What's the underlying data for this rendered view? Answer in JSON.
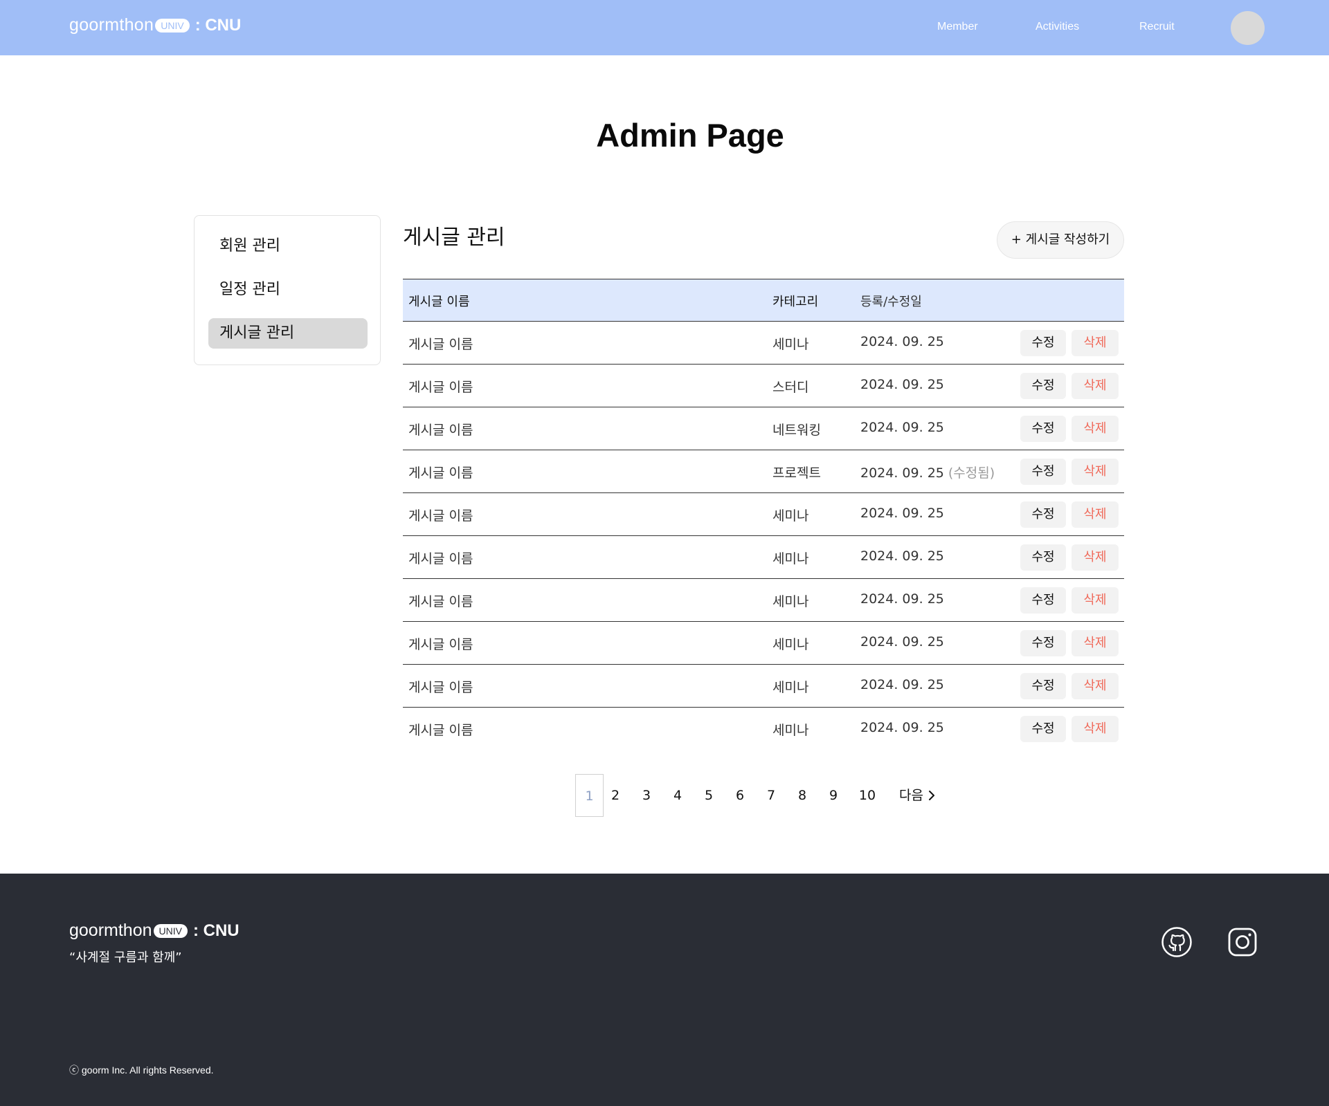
{
  "header": {
    "logo": {
      "wordmark": "goormthon",
      "badge": "UNIV",
      "suffix": ": CNU"
    },
    "nav": [
      "Member",
      "Activities",
      "Recruit"
    ]
  },
  "page_title": "Admin Page",
  "sidebar": {
    "items": [
      "회원 관리",
      "일정 관리",
      "게시글 관리"
    ],
    "active_index": 2
  },
  "section": {
    "title": "게시글 관리",
    "write_button": "+ 게시글 작성하기"
  },
  "table": {
    "headers": [
      "게시글 이름",
      "카테고리",
      "등록/수정일"
    ],
    "edit_label": "수정",
    "delete_label": "삭제",
    "rows": [
      {
        "name": "게시글 이름",
        "category": "세미나",
        "date": "2024. 09. 25",
        "note": ""
      },
      {
        "name": "게시글 이름",
        "category": "스터디",
        "date": "2024. 09. 25",
        "note": ""
      },
      {
        "name": "게시글 이름",
        "category": "네트워킹",
        "date": "2024. 09. 25",
        "note": ""
      },
      {
        "name": "게시글 이름",
        "category": "프로젝트",
        "date": "2024. 09. 25",
        "note": "(수정됨)"
      },
      {
        "name": "게시글 이름",
        "category": "세미나",
        "date": "2024. 09. 25",
        "note": ""
      },
      {
        "name": "게시글 이름",
        "category": "세미나",
        "date": "2024. 09. 25",
        "note": ""
      },
      {
        "name": "게시글 이름",
        "category": "세미나",
        "date": "2024. 09. 25",
        "note": ""
      },
      {
        "name": "게시글 이름",
        "category": "세미나",
        "date": "2024. 09. 25",
        "note": ""
      },
      {
        "name": "게시글 이름",
        "category": "세미나",
        "date": "2024. 09. 25",
        "note": ""
      },
      {
        "name": "게시글 이름",
        "category": "세미나",
        "date": "2024. 09. 25",
        "note": ""
      }
    ]
  },
  "pagination": {
    "pages": [
      "1",
      "2",
      "3",
      "4",
      "5",
      "6",
      "7",
      "8",
      "9",
      "10"
    ],
    "current": "1",
    "next_label": "다음"
  },
  "footer": {
    "logo": {
      "wordmark": "goormthon",
      "badge": "UNIV",
      "suffix": ": CNU"
    },
    "slogan": "“사계절 구름과 함께”",
    "copyright": "ⓒ goorm Inc. All rights Reserved.",
    "social_icons": [
      "github-icon",
      "instagram-icon"
    ]
  },
  "colors": {
    "header_bg": "#a0bef7",
    "table_header_bg": "#dde8fd",
    "delete_text": "#f06a5a",
    "footer_bg": "#2a2d35",
    "sidebar_active_bg": "#d9d9d9"
  }
}
